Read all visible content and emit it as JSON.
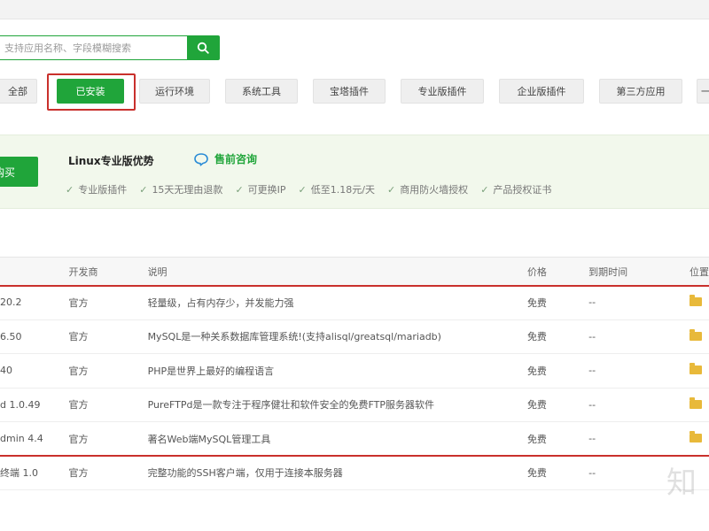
{
  "search": {
    "placeholder": "支持应用名称、字段模糊搜索"
  },
  "tabs": [
    {
      "label": "全部"
    },
    {
      "label": "已安装"
    },
    {
      "label": "运行环境"
    },
    {
      "label": "系统工具"
    },
    {
      "label": "宝塔插件"
    },
    {
      "label": "专业版插件"
    },
    {
      "label": "企业版插件"
    },
    {
      "label": "第三方应用"
    },
    {
      "label": "一"
    }
  ],
  "promo": {
    "buy_label": "购买",
    "title": "Linux专业版优势",
    "consult_label": "售前咨询",
    "features": [
      "专业版插件",
      "15天无理由退款",
      "可更换IP",
      "低至1.18元/天",
      "商用防火墙授权",
      "产品授权证书"
    ]
  },
  "table": {
    "headers": {
      "name": "",
      "developer": "开发商",
      "description": "说明",
      "price": "价格",
      "expire": "到期时间",
      "position": "位置"
    },
    "rows": [
      {
        "name": "20.2",
        "developer": "官方",
        "description": "轻量级，占有内存少，并发能力强",
        "price": "免费",
        "expire": "--"
      },
      {
        "name": "6.50",
        "developer": "官方",
        "description": "MySQL是一种关系数据库管理系统!(支持alisql/greatsql/mariadb)",
        "price": "免费",
        "expire": "--"
      },
      {
        "name": "40",
        "developer": "官方",
        "description": "PHP是世界上最好的编程语言",
        "price": "免费",
        "expire": "--"
      },
      {
        "name": "d 1.0.49",
        "developer": "官方",
        "description": "PureFTPd是一款专注于程序健壮和软件安全的免费FTP服务器软件",
        "price": "免费",
        "expire": "--"
      },
      {
        "name": "dmin 4.4",
        "developer": "官方",
        "description": "著名Web端MySQL管理工具",
        "price": "免费",
        "expire": "--"
      },
      {
        "name": "终端 1.0",
        "developer": "官方",
        "description": "完整功能的SSH客户端，仅用于连接本服务器",
        "price": "免费",
        "expire": "--"
      }
    ]
  },
  "watermark": "知",
  "colors": {
    "accent": "#20a53a",
    "highlight": "#c9302c"
  }
}
